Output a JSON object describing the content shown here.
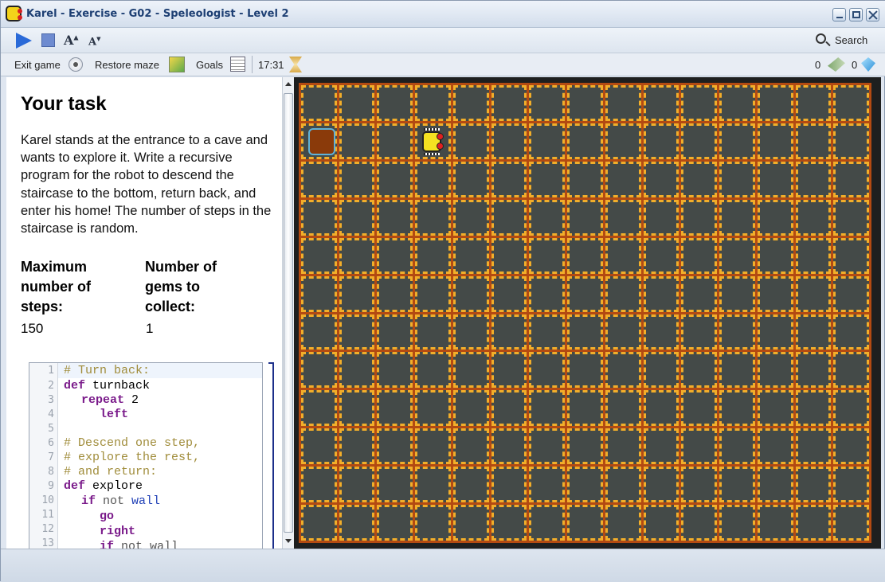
{
  "window": {
    "title": "Karel - Exercise - G02 - Speleologist - Level 2"
  },
  "toolbar": {
    "search_label": "Search",
    "font_up": "A",
    "font_down": "A"
  },
  "menubar": {
    "exit_label": "Exit game",
    "restore_label": "Restore maze",
    "goals_label": "Goals",
    "time": "17:31",
    "steps": "0",
    "gems": "0"
  },
  "task": {
    "title": "Your task",
    "text": "Karel stands at the entrance to a cave and wants to explore it. Write a recursive program for the robot to descend the staircase to the bottom, return back, and enter his home! The number of steps in the staircase is random.",
    "max_steps_label": "Maximum number of steps:",
    "max_steps_value": "150",
    "gems_label": "Number of gems to collect:",
    "gems_value": "1"
  },
  "code": {
    "line_numbers": [
      "1",
      "2",
      "3",
      "4",
      "5",
      "6",
      "7",
      "8",
      "9",
      "10",
      "11",
      "12",
      "13"
    ],
    "lines": {
      "l1": "# Turn back:",
      "l2_kw": "def",
      "l2_rest": " turnback",
      "l3_kw": "repeat",
      "l3_rest": " 2",
      "l4_kw": "left",
      "l6": "# Descend one step,",
      "l7": "# explore the rest,",
      "l8": "# and return:",
      "l9_kw": "def",
      "l9_rest": " explore",
      "l10_kw": "if",
      "l10_not": " not",
      "l10_wall": " wall",
      "l11_kw": "go",
      "l12_kw": "right",
      "l13_kw": "if",
      "l13_rest": " not wall"
    }
  },
  "maze": {
    "rows": 12,
    "cols": 15
  }
}
